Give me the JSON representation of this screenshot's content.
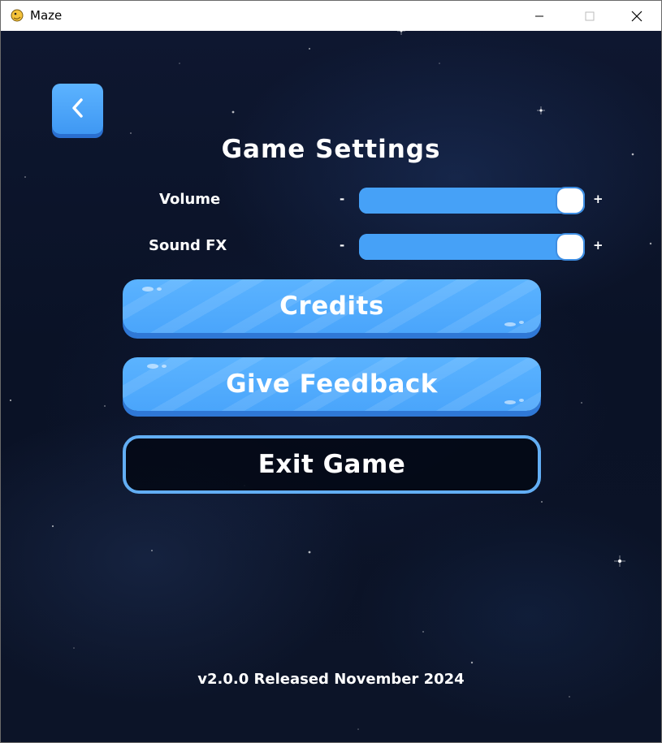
{
  "window": {
    "title": "Maze",
    "controls": {
      "minimize": "minimize-icon",
      "maximize": "maximize-icon",
      "close": "close-icon"
    }
  },
  "header": {
    "back_icon": "chevron-left-icon",
    "title": "Game Settings"
  },
  "settings": {
    "volume": {
      "label": "Volume",
      "minus": "-",
      "plus": "+",
      "level": 1.0
    },
    "sound_fx": {
      "label": "Sound FX",
      "minus": "-",
      "plus": "+",
      "level": 1.0
    }
  },
  "buttons": {
    "credits": "Credits",
    "feedback": "Give Feedback",
    "exit": "Exit Game"
  },
  "footer": {
    "version": "v2.0.0 Released November 2024"
  },
  "colors": {
    "accent": "#46a1f7",
    "accent_shadow": "#2f78d6",
    "background": "#0b1226",
    "text": "#ffffff"
  }
}
